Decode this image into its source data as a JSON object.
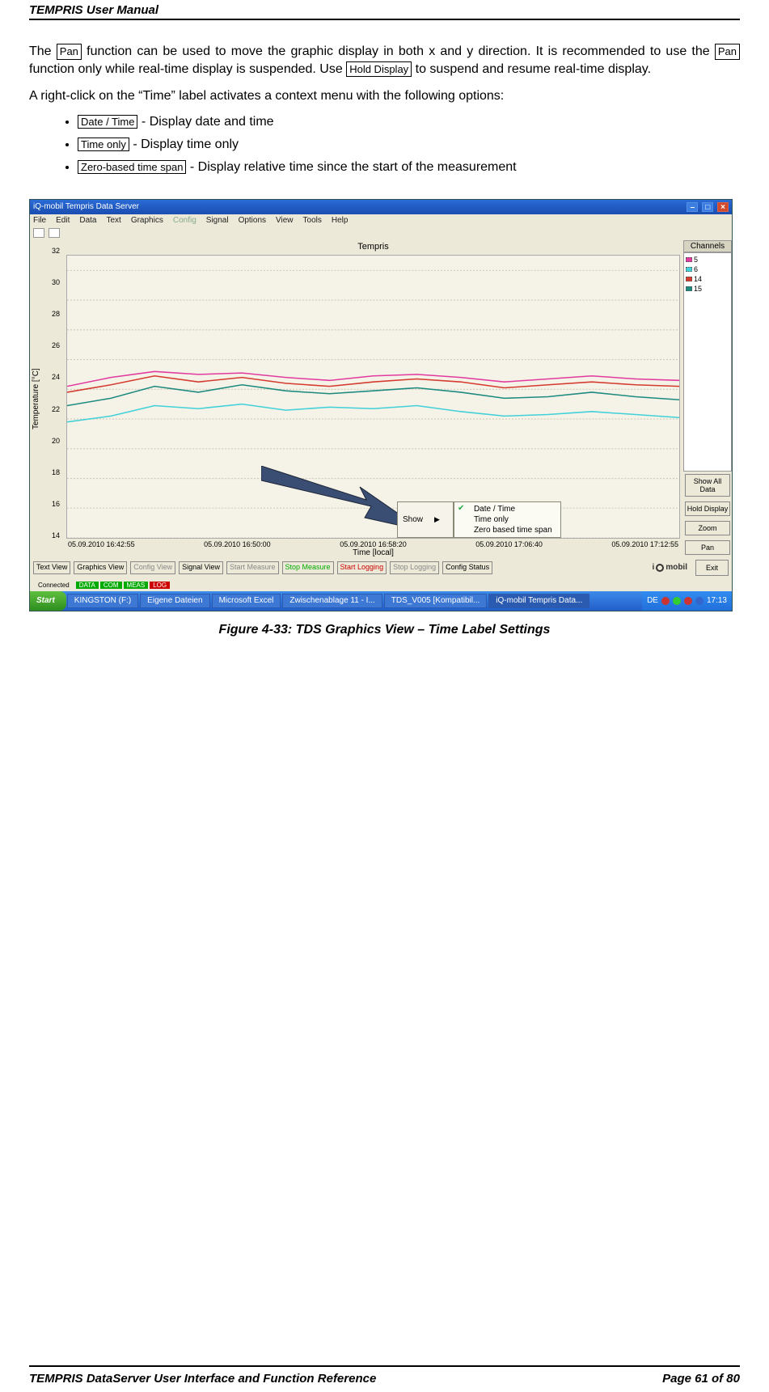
{
  "header": {
    "title": "TEMPRIS User Manual"
  },
  "footer": {
    "left": "TEMPRIS DataServer User Interface and Function Reference",
    "right": "Page 61 of 80"
  },
  "body": {
    "para1_a": "The ",
    "para1_pan": "Pan",
    "para1_b": " function can be used to move the graphic display in both x and y direction. It is recommended to use the ",
    "para1_pan2": "Pan",
    "para1_c": " function only while real-time display is suspended. Use ",
    "para1_hold": "Hold Display",
    "para1_d": " to suspend and resume real-time display.",
    "para2": "A right-click on the “Time” label activates a context menu with the following options:",
    "opts": {
      "o1": "Date / Time",
      "o1_t": " - Display date and time",
      "o2": "Time only",
      "o2_t": " - Display time only",
      "o3": "Zero-based time span",
      "o3_t": " - Display relative time since the start of the measurement"
    }
  },
  "caption": "Figure 4-33: TDS Graphics View – Time Label Settings",
  "app": {
    "title": "iQ-mobil Tempris Data Server",
    "win_btns": [
      "–",
      "□",
      "×"
    ],
    "menus": [
      "File",
      "Edit",
      "Data",
      "Text",
      "Graphics",
      "Config",
      "Signal",
      "Options",
      "View",
      "Tools",
      "Help"
    ],
    "menu_disabled_index": 5,
    "chart": {
      "title": "Tempris",
      "ylabel": "Temperature [°C]",
      "xlabel": "Time",
      "xaxis_partial": "Time [local]",
      "yticks": [
        "32",
        "30",
        "28",
        "26",
        "24",
        "22",
        "20",
        "18",
        "16",
        "14"
      ],
      "xticks": [
        "05.09.2010 16:42:55",
        "05.09.2010 16:50:00",
        "05.09.2010 16:58:20",
        "05.09.2010 17:06:40",
        "05.09.2010 17:12:55"
      ]
    },
    "channels_header": "Channels",
    "channels": [
      {
        "id": "5",
        "color": "#e23b9f"
      },
      {
        "id": "6",
        "color": "#3fd0d8"
      },
      {
        "id": "14",
        "color": "#d53a2e"
      },
      {
        "id": "15",
        "color": "#1c8a7e"
      }
    ],
    "side_buttons": [
      "Show All Data",
      "Hold Display",
      "Zoom",
      "Pan"
    ],
    "ctx": {
      "show": "Show",
      "items": [
        "Date / Time",
        "Time only",
        "Zero based time span"
      ]
    },
    "bottom_buttons": [
      {
        "t": "Text\nView",
        "c": ""
      },
      {
        "t": "Graphics\nView",
        "c": ""
      },
      {
        "t": "Config\nView",
        "c": "gray"
      },
      {
        "t": "Signal\nView",
        "c": ""
      },
      {
        "t": "Start\nMeasure",
        "c": "gray"
      },
      {
        "t": "Stop\nMeasure",
        "c": "green"
      },
      {
        "t": "Start\nLogging",
        "c": "red"
      },
      {
        "t": "Stop\nLogging",
        "c": "gray"
      },
      {
        "t": "Config\nStatus",
        "c": ""
      }
    ],
    "exit": "Exit",
    "logo": "mobil",
    "status": {
      "label": "Connected",
      "cells": [
        {
          "t": "DATA",
          "c": "green"
        },
        {
          "t": "COM",
          "c": "green"
        },
        {
          "t": "MEAS",
          "c": "green"
        },
        {
          "t": "LOG",
          "c": "red"
        }
      ]
    },
    "taskbar": {
      "start": "Start",
      "tasks": [
        {
          "t": "KINGSTON (F:)"
        },
        {
          "t": "Eigene Dateien"
        },
        {
          "t": "Microsoft Excel"
        },
        {
          "t": "Zwischenablage 11 - I..."
        },
        {
          "t": "TDS_V005 [Kompatibil..."
        },
        {
          "t": "iQ-mobil Tempris Data...",
          "active": true
        }
      ],
      "tray": {
        "de": "DE",
        "time": "17:13"
      }
    }
  },
  "chart_data": {
    "type": "line",
    "title": "Tempris",
    "xlabel": "Time [local]",
    "ylabel": "Temperature [°C]",
    "ylim": [
      14,
      33
    ],
    "x": [
      "05.09.2010 16:42:55",
      "05.09.2010 16:50:00",
      "05.09.2010 16:58:20",
      "05.09.2010 17:06:40",
      "05.09.2010 17:12:55"
    ],
    "series": [
      {
        "name": "5",
        "color": "#e23b9f",
        "values": [
          24.2,
          24.8,
          25.2,
          25.0,
          25.1,
          24.8,
          24.6,
          24.9,
          25.0,
          24.8,
          24.5,
          24.7,
          24.9,
          24.7,
          24.6
        ]
      },
      {
        "name": "6",
        "color": "#3fd0d8",
        "values": [
          21.8,
          22.2,
          22.9,
          22.7,
          23.0,
          22.6,
          22.8,
          22.7,
          22.9,
          22.5,
          22.2,
          22.3,
          22.5,
          22.3,
          22.1
        ]
      },
      {
        "name": "14",
        "color": "#d53a2e",
        "values": [
          23.8,
          24.3,
          24.9,
          24.5,
          24.8,
          24.4,
          24.2,
          24.5,
          24.7,
          24.5,
          24.1,
          24.3,
          24.5,
          24.3,
          24.2
        ]
      },
      {
        "name": "15",
        "color": "#1c8a7e",
        "values": [
          22.9,
          23.4,
          24.2,
          23.8,
          24.3,
          23.9,
          23.7,
          23.9,
          24.1,
          23.8,
          23.4,
          23.5,
          23.8,
          23.5,
          23.3
        ]
      }
    ]
  }
}
